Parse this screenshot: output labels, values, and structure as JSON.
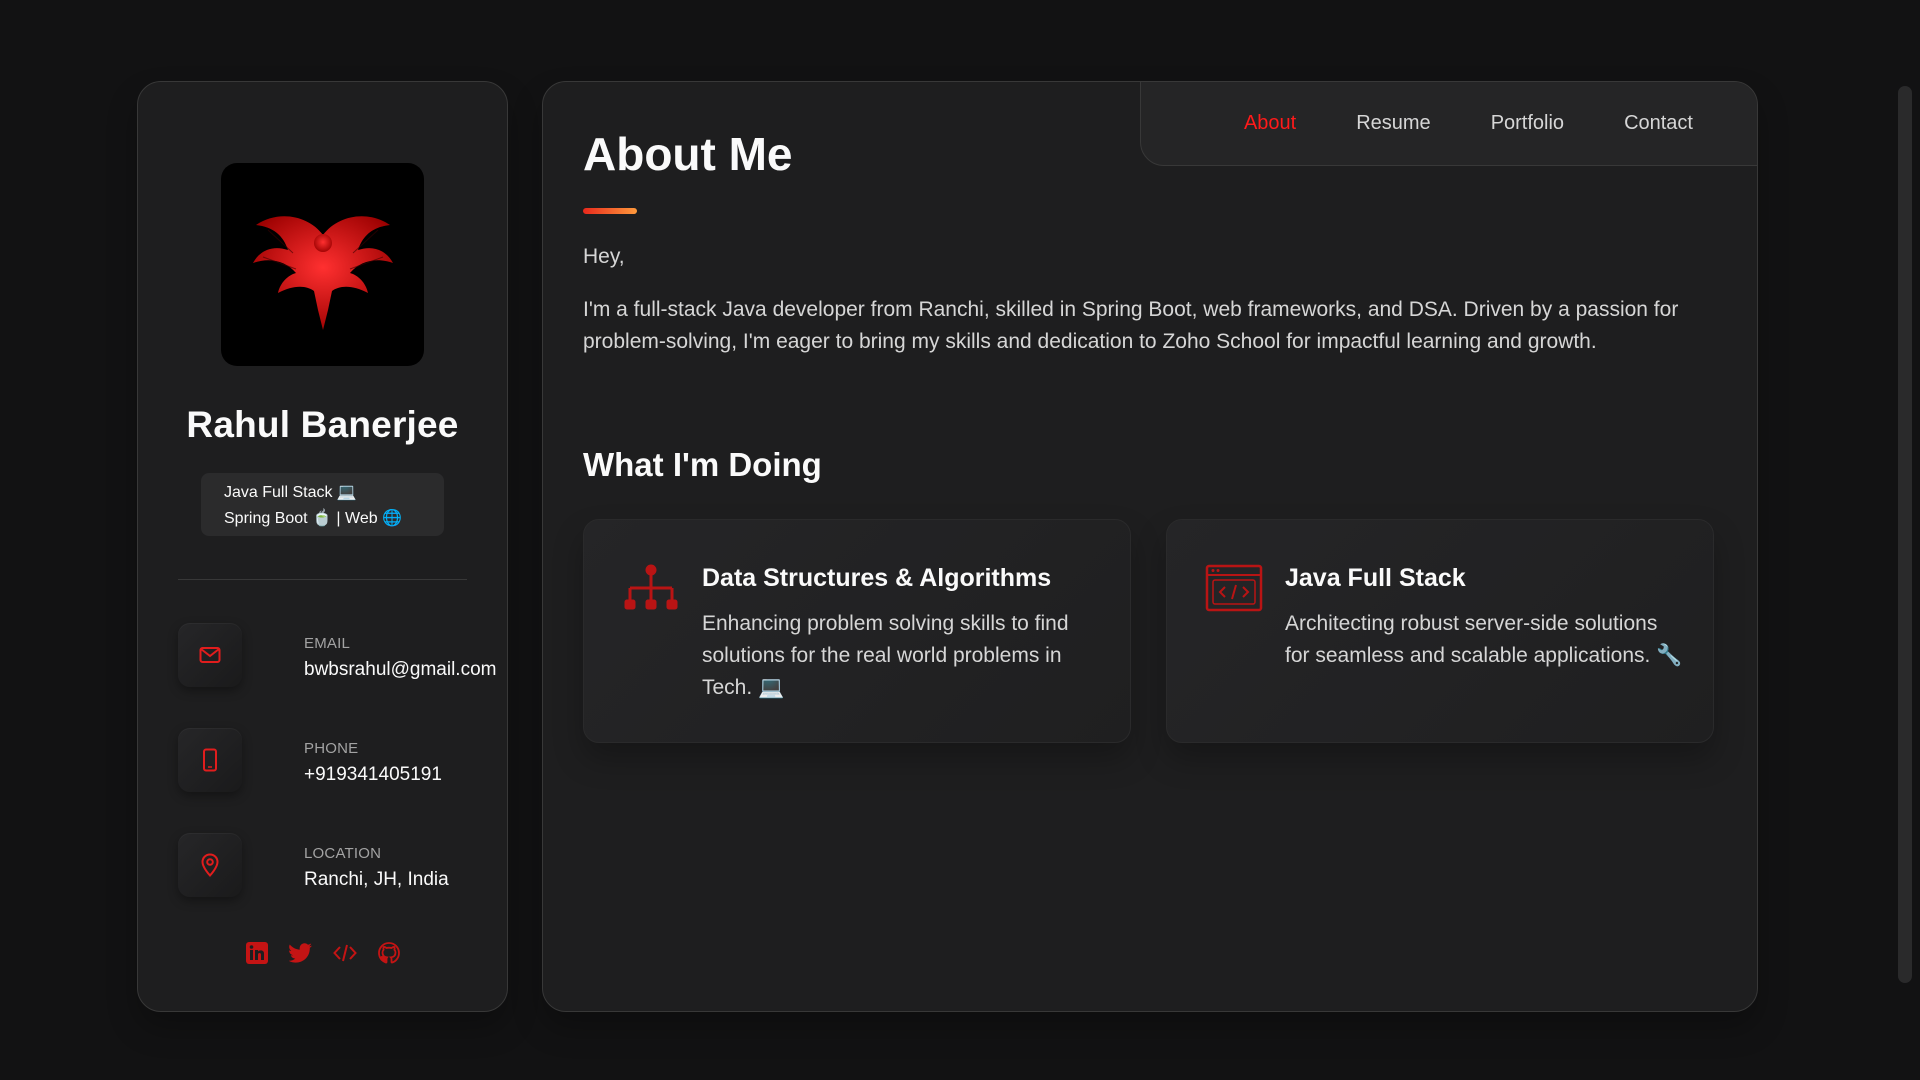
{
  "sidebar": {
    "name": "Rahul Banerjee",
    "title_line1": "Java Full Stack 💻",
    "title_line2": "Spring Boot 🍵 | Web 🌐",
    "contacts": [
      {
        "label": "Email",
        "value": "bwbsrahul@gmail.com",
        "icon": "mail-icon"
      },
      {
        "label": "Phone",
        "value": "+919341405191",
        "icon": "phone-icon"
      },
      {
        "label": "Location",
        "value": "Ranchi, JH, India",
        "icon": "location-pin-icon"
      }
    ],
    "socials": [
      "linkedin-icon",
      "twitter-icon",
      "code-icon",
      "github-icon"
    ]
  },
  "nav": {
    "items": [
      "About",
      "Resume",
      "Portfolio",
      "Contact"
    ],
    "active": "About"
  },
  "about": {
    "title": "About Me",
    "greeting": "Hey,",
    "text": "I'm a full-stack Java developer from Ranchi, skilled in Spring Boot, web frameworks, and DSA. Driven by a passion for problem-solving, I'm eager to bring my skills and dedication to Zoho School for impactful learning and growth.",
    "section_title": "What I'm Doing",
    "services": [
      {
        "title": "Data Structures & Algorithms",
        "desc": "Enhancing problem solving skills to find solutions for the real world problems in Tech. 💻",
        "icon": "hierarchy-icon"
      },
      {
        "title": "Java Full Stack",
        "desc": "Architecting robust server-side solutions for seamless and scalable applications. 🔧",
        "icon": "code-window-icon"
      }
    ]
  },
  "colors": {
    "accent": "#ff1a1a",
    "background": "#121213",
    "panel": "#1e1e1f"
  }
}
